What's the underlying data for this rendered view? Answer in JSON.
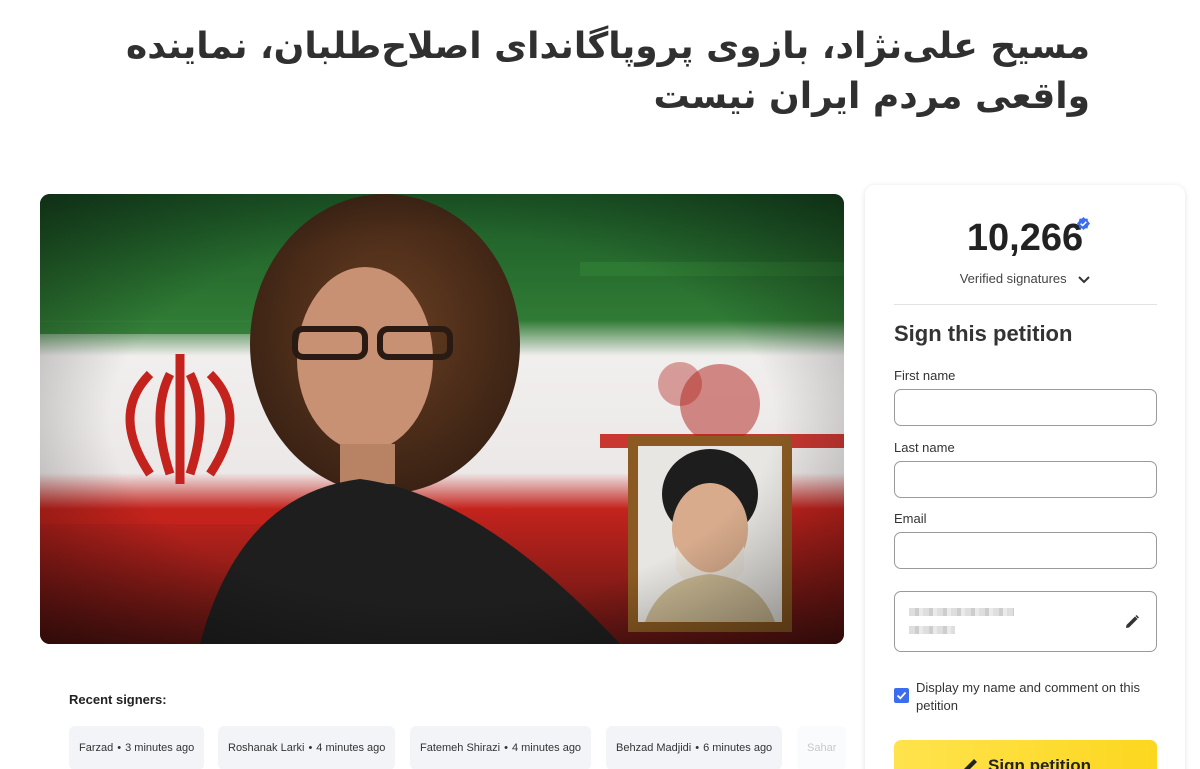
{
  "petition": {
    "title": "مسیح علی‌نژاد، بازوی پروپاگاندای اصلاح‌طلبان، نماینده واقعی مردم ایران نیست"
  },
  "recent_signers": {
    "label": "Recent signers:",
    "items": [
      {
        "name": "Farzad",
        "time": "3 minutes ago"
      },
      {
        "name": "Roshanak Larki",
        "time": "4 minutes ago"
      },
      {
        "name": "Fatemeh Shirazi",
        "time": "4 minutes ago"
      },
      {
        "name": "Behzad Madjidi",
        "time": "6 minutes ago"
      },
      {
        "name": "Sahar",
        "time": ""
      }
    ]
  },
  "signatures": {
    "count": "10,266",
    "label": "Verified signatures",
    "badge_icon": "verified-check-icon",
    "accent": "#3c6df0"
  },
  "form": {
    "heading": "Sign this petition",
    "first_name_label": "First name",
    "first_name_value": "",
    "last_name_label": "Last name",
    "last_name_value": "",
    "email_label": "Email",
    "email_value": "",
    "display_checkbox_label": "Display my name and comment on this petition",
    "display_checked": true,
    "submit_label": "Sign petition",
    "submit_color": "#fcd71f"
  }
}
